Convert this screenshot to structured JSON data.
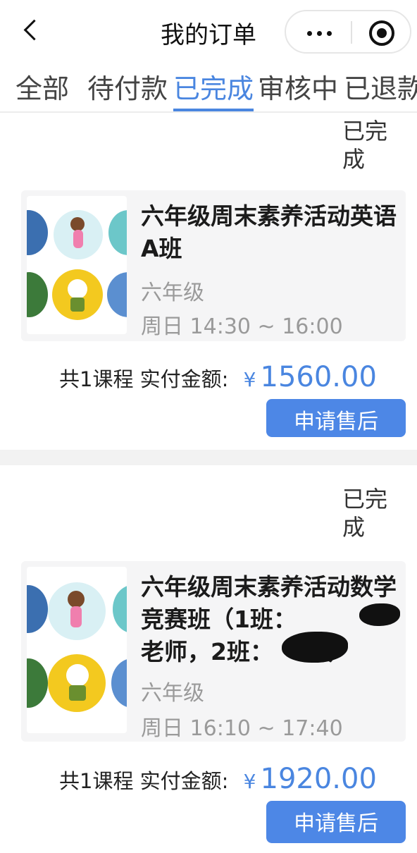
{
  "navbar": {
    "title": "我的订单"
  },
  "tabs": [
    {
      "label": "全部"
    },
    {
      "label": "待付款"
    },
    {
      "label": "已完成"
    },
    {
      "label": "审核中"
    },
    {
      "label": "已退款"
    }
  ],
  "orders": [
    {
      "status": "已完成",
      "course_name": "六年级周末素养活动英语A班",
      "grade": "六年级",
      "time": "周日 14:30 ~ 16:00",
      "count_label": "共1课程",
      "amount_label": "实付金额:",
      "currency": "¥",
      "amount": "1560.00",
      "button_label": "申请售后"
    },
    {
      "status": "已完成",
      "course_name": "六年级周末素养活动数学竞赛班（1班：",
      "course_name_line2": "老师，2班：",
      "course_name_tail": "）",
      "grade": "六年级",
      "time": "周日 16:10 ~ 17:40",
      "count_label": "共1课程",
      "amount_label": "实付金额:",
      "currency": "¥",
      "amount": "1920.00",
      "button_label": "申请售后"
    }
  ],
  "colors": {
    "accent": "#4a86e0",
    "button": "#4d87e6",
    "muted": "#9a9a9a"
  }
}
